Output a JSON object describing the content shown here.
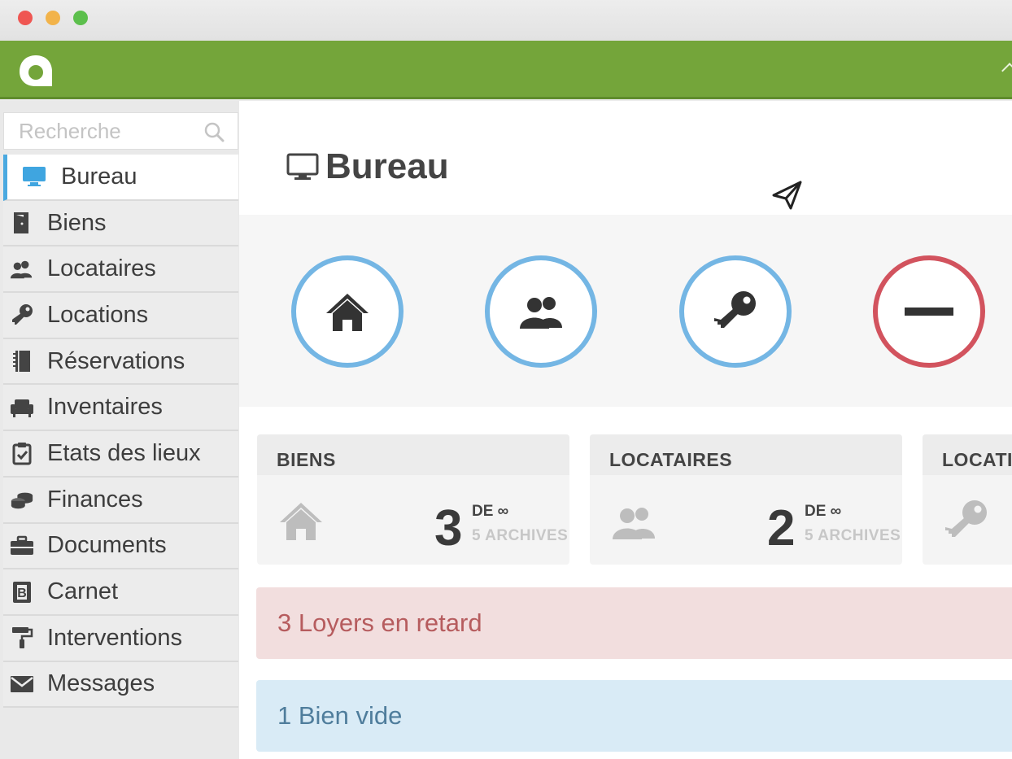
{
  "search": {
    "placeholder": "Recherche"
  },
  "sidebar": {
    "items": [
      {
        "label": "Bureau",
        "icon": "monitor-icon",
        "active": true
      },
      {
        "label": "Biens",
        "icon": "door-icon"
      },
      {
        "label": "Locataires",
        "icon": "users-icon"
      },
      {
        "label": "Locations",
        "icon": "key-icon"
      },
      {
        "label": "Réservations",
        "icon": "notebook-icon"
      },
      {
        "label": "Inventaires",
        "icon": "armchair-icon"
      },
      {
        "label": "Etats des lieux",
        "icon": "checklist-icon"
      },
      {
        "label": "Finances",
        "icon": "coins-icon"
      },
      {
        "label": "Documents",
        "icon": "briefcase-icon"
      },
      {
        "label": "Carnet",
        "icon": "address-book-icon"
      },
      {
        "label": "Interventions",
        "icon": "paint-roller-icon"
      },
      {
        "label": "Messages",
        "icon": "envelope-icon"
      }
    ]
  },
  "main": {
    "title": "Bureau",
    "quick_actions": [
      {
        "icon": "house-icon"
      },
      {
        "icon": "users-icon"
      },
      {
        "icon": "key-icon"
      },
      {
        "icon": "minus-icon"
      }
    ],
    "stats": [
      {
        "label": "BIENS",
        "count": "3",
        "of": "DE ∞",
        "archives": "5 ARCHIVES",
        "icon": "house-icon"
      },
      {
        "label": "LOCATAIRES",
        "count": "2",
        "of": "DE ∞",
        "archives": "5 ARCHIVES",
        "icon": "users-icon"
      },
      {
        "label": "LOCATIONS",
        "icon": "key-icon"
      }
    ],
    "alerts": {
      "late_rent": "3 Loyers en retard",
      "empty_property": "1 Bien vide"
    }
  },
  "colors": {
    "brand_green": "#74a53a",
    "accent_blue": "#74b6e4",
    "accent_red": "#d2535e",
    "active_blue": "#4aa9e0"
  }
}
